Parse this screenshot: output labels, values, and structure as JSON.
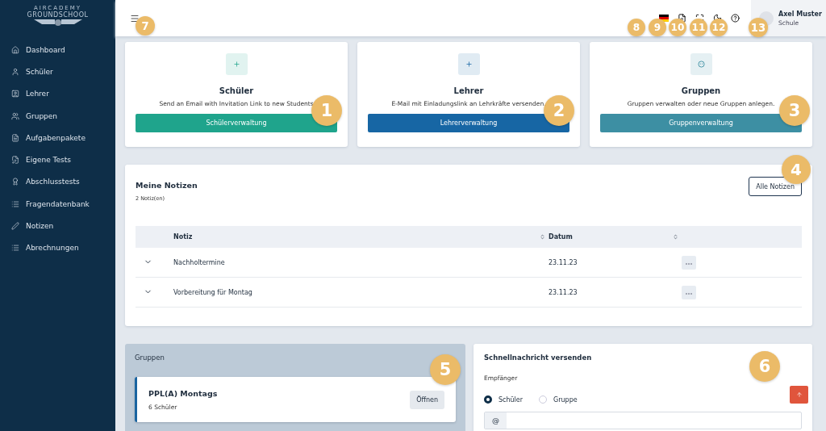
{
  "logo": {
    "line1": "AIRCADEMY",
    "line2": "GROUNDSCHOOL"
  },
  "sidebar": {
    "items": [
      {
        "label": "Dashboard"
      },
      {
        "label": "Schüler"
      },
      {
        "label": "Lehrer"
      },
      {
        "label": "Gruppen"
      },
      {
        "label": "Aufgabenpakete"
      },
      {
        "label": "Eigene Tests"
      },
      {
        "label": "Abschlusstests"
      },
      {
        "label": "Fragendatenbank"
      },
      {
        "label": "Notizen"
      },
      {
        "label": "Abrechnungen"
      }
    ]
  },
  "user": {
    "name": "Axel Muster",
    "role": "Schule"
  },
  "cards": [
    {
      "title": "Schüler",
      "text": "Send an Email with Invitation Link to new Students",
      "button": "Schülerverwaltung",
      "color": "#1fa48c"
    },
    {
      "title": "Lehrer",
      "text": "E-Mail mit Einladungslink an Lehrkräfte versenden.",
      "button": "Lehrerverwaltung",
      "color": "#1766a4"
    },
    {
      "title": "Gruppen",
      "text": "Gruppen verwalten oder neue Gruppen anlegen.",
      "button": "Gruppenverwaltung",
      "color": "#3d8fa3"
    }
  ],
  "notes": {
    "title": "Meine Notizen",
    "count": "2 Notiz(en)",
    "all_button": "Alle Notizen",
    "columns": [
      "Notiz",
      "Datum"
    ],
    "rows": [
      {
        "note": "Nachholtermine",
        "date": "23.11.23"
      },
      {
        "note": "Vorbereitung für Montag",
        "date": "23.11.23"
      }
    ]
  },
  "groups": {
    "title": "Gruppen",
    "items": [
      {
        "name": "PPL(A) Montags",
        "members": "6 Schüler",
        "button": "Öffnen"
      }
    ]
  },
  "message": {
    "title": "Schnellnachricht versenden",
    "recipient_label": "Empfänger",
    "options": [
      {
        "label": "Schüler",
        "selected": true
      },
      {
        "label": "Gruppe",
        "selected": false
      }
    ],
    "at": "@"
  },
  "callouts": [
    "1",
    "2",
    "3",
    "4",
    "5",
    "6",
    "7",
    "8",
    "9",
    "10",
    "11",
    "12",
    "13"
  ]
}
